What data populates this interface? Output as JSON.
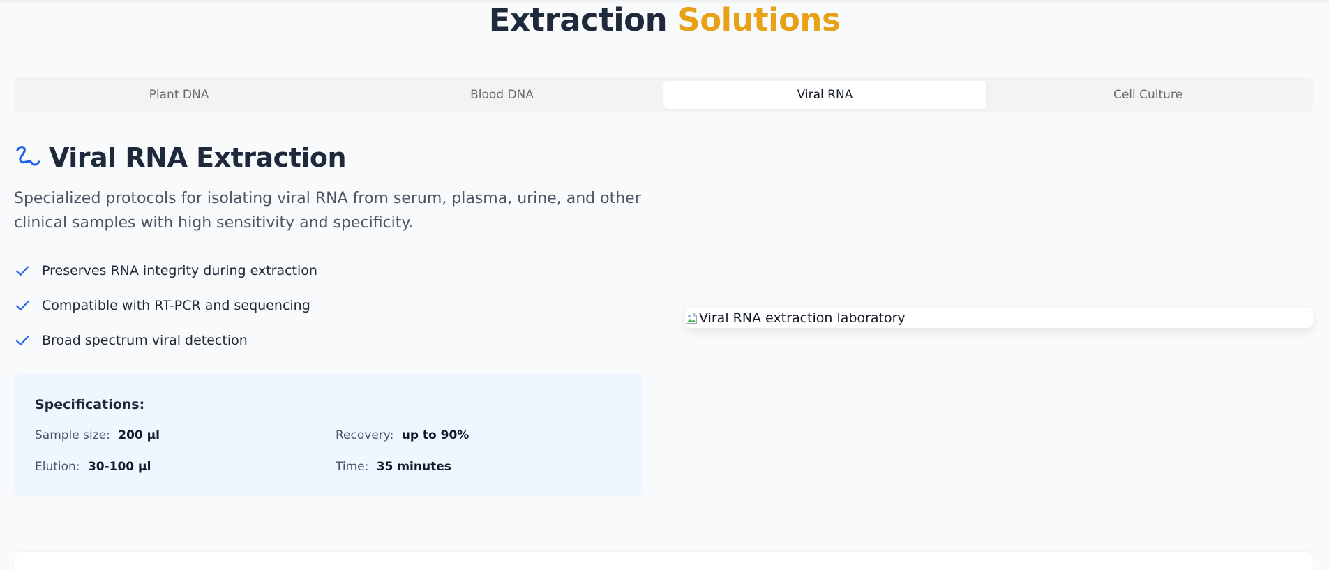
{
  "header": {
    "title_main": "Extraction",
    "title_accent": "Solutions",
    "accent_color": "#e6a117"
  },
  "tabs": [
    {
      "label": "Plant DNA",
      "active": false
    },
    {
      "label": "Blood DNA",
      "active": false
    },
    {
      "label": "Viral RNA",
      "active": true
    },
    {
      "label": "Cell Culture",
      "active": false
    }
  ],
  "section": {
    "icon": "wave-icon",
    "icon_color": "#2563eb",
    "title": "Viral RNA Extraction",
    "description": "Specialized protocols for isolating viral RNA from serum, plasma, urine, and other clinical samples with high sensitivity and specificity.",
    "features": [
      "Preserves RNA integrity during extraction",
      "Compatible with RT-PCR and sequencing",
      "Broad spectrum viral detection"
    ],
    "feature_icon": "check-icon"
  },
  "specifications": {
    "title": "Specifications:",
    "items": [
      {
        "label": "Sample size:",
        "value": "200 µl"
      },
      {
        "label": "Recovery:",
        "value": "up to 90%"
      },
      {
        "label": "Elution:",
        "value": "30-100 µl"
      },
      {
        "label": "Time:",
        "value": "35 minutes"
      }
    ]
  },
  "image": {
    "alt": "Viral RNA extraction laboratory",
    "icon": "broken-image-icon"
  }
}
